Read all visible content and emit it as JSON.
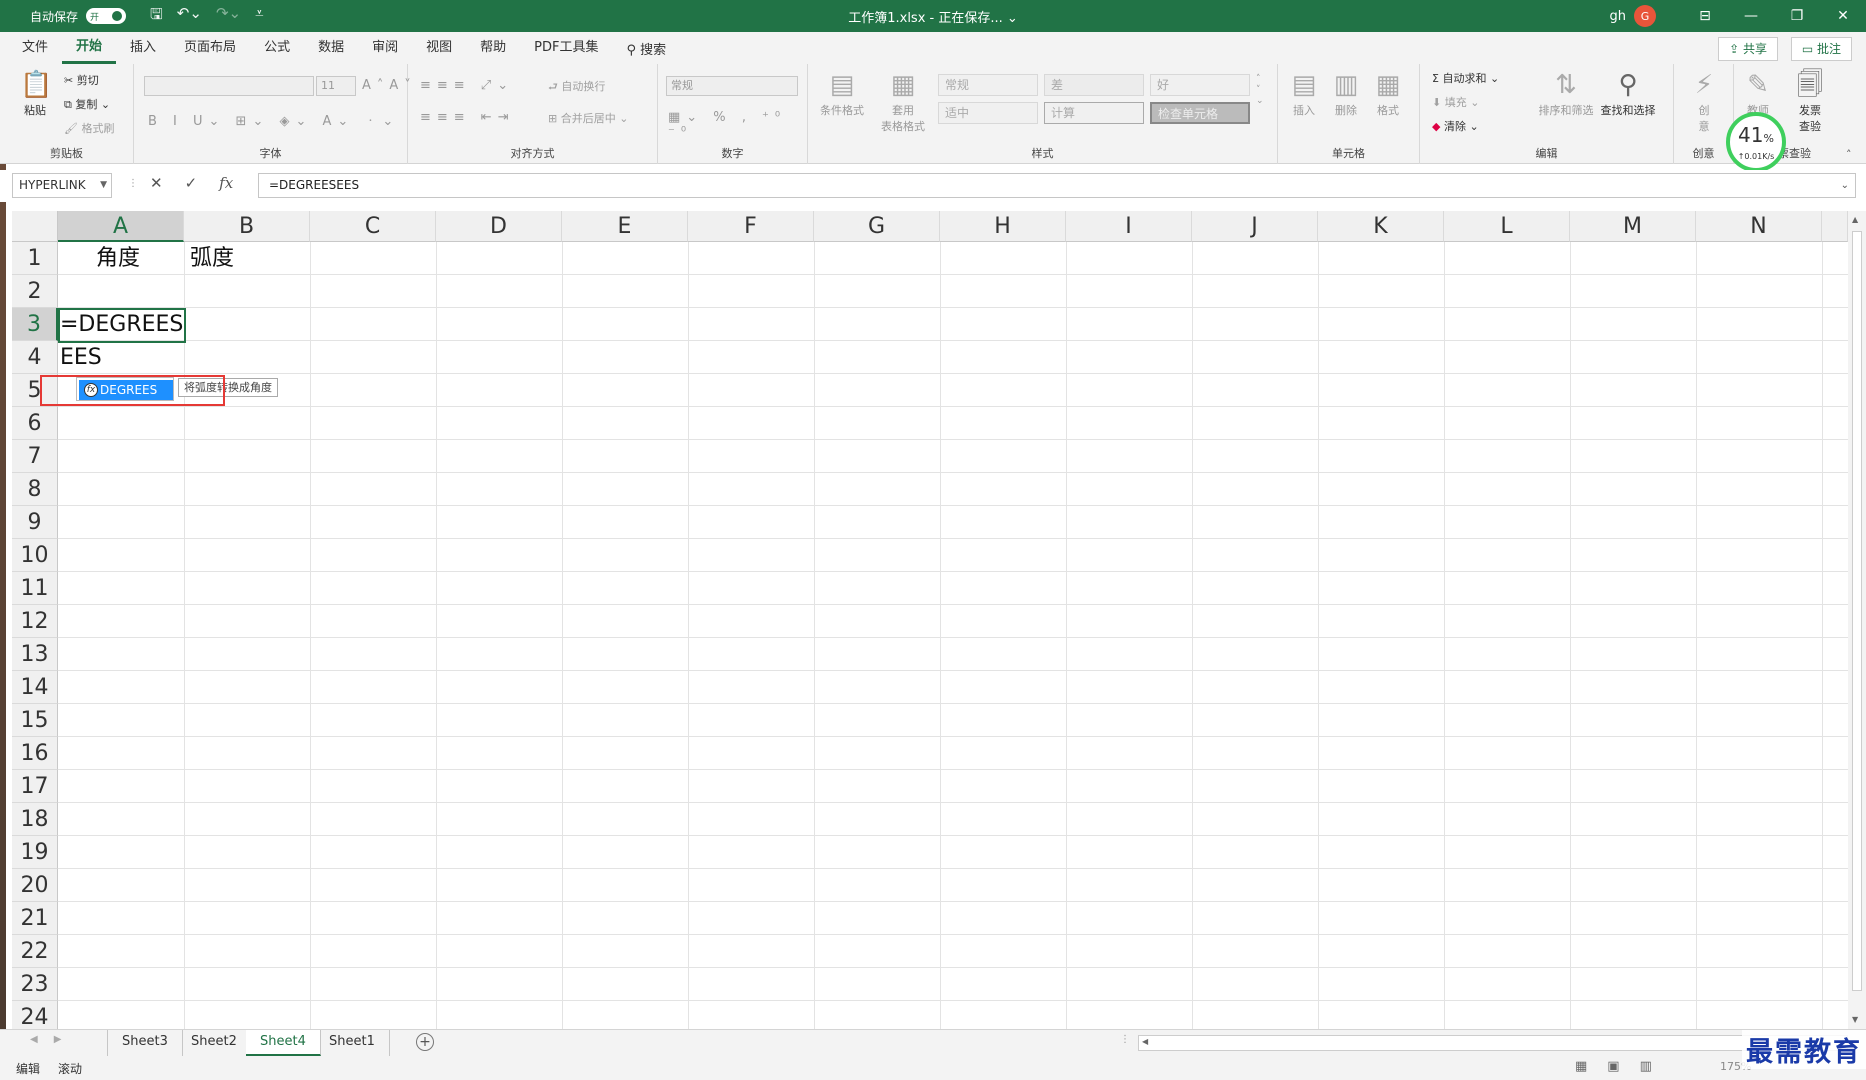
{
  "titlebar": {
    "autosave_label": "自动保存",
    "autosave_state": "开",
    "title": "工作簿1.xlsx  -  正在保存...  ⌄",
    "user": "gh",
    "avatar_letter": "G"
  },
  "tabs": [
    "文件",
    "开始",
    "插入",
    "页面布局",
    "公式",
    "数据",
    "审阅",
    "视图",
    "帮助",
    "PDF工具集"
  ],
  "active_tab": "开始",
  "search_label": "搜索",
  "share_label": "共享",
  "comment_label": "批注",
  "ribbon": {
    "clipboard": {
      "paste": "粘贴",
      "cut": "剪切",
      "copy": "复制",
      "format_painter": "格式刷",
      "label": "剪贴板"
    },
    "font": {
      "size": "11",
      "label": "字体"
    },
    "alignment": {
      "wrap": "自动换行",
      "merge": "合并后居中",
      "label": "对齐方式"
    },
    "number": {
      "format": "常规",
      "label": "数字"
    },
    "styles": {
      "conditional": "条件格式",
      "table": "套用\n表格格式",
      "boxes": [
        "常规",
        "差",
        "好",
        "适中",
        "计算",
        "检查单元格"
      ],
      "label": "样式"
    },
    "cells": {
      "insert": "插入",
      "delete": "删除",
      "format": "格式",
      "label": "单元格"
    },
    "editing": {
      "autosum": "自动求和",
      "fill": "填充",
      "clear": "清除",
      "sort": "排序和筛选",
      "find": "查找和选择",
      "label": "编辑"
    },
    "create": {
      "create": "创\n意",
      "label": "创意"
    },
    "invoice": {
      "btn1": "教师",
      "btn2": "发票\n查验",
      "label": "发票查验"
    }
  },
  "perf": {
    "percent": "41",
    "pct_sign": "%",
    "speed": "↑0.01K/s"
  },
  "formula_bar": {
    "name_box": "HYPERLINK",
    "formula": "=DEGREESEES"
  },
  "columns": [
    "A",
    "B",
    "C",
    "D",
    "E",
    "F",
    "G",
    "H",
    "I",
    "J",
    "K",
    "L",
    "M",
    "N"
  ],
  "rows": [
    "1",
    "2",
    "3",
    "4",
    "5",
    "6",
    "7",
    "8",
    "9",
    "10",
    "11",
    "12",
    "13",
    "14",
    "15",
    "16",
    "17",
    "18",
    "19",
    "20",
    "21",
    "22",
    "23",
    "24"
  ],
  "cells": {
    "A1": "角度",
    "B1": "弧度",
    "A3": "=DEGREES",
    "A4": "EES"
  },
  "autocomplete": {
    "item": "DEGREES",
    "tooltip": "将弧度转换成角度"
  },
  "sheets": [
    "Sheet3",
    "Sheet2",
    "Sheet4",
    "Sheet1"
  ],
  "active_sheet": "Sheet4",
  "status": {
    "mode": "编辑",
    "scroll": "滚动",
    "zoom": "175%"
  },
  "watermark": "最需教育",
  "colors": {
    "excel_green": "#217346",
    "selection_blue": "#1e90ff",
    "highlight_red": "#e53935"
  }
}
